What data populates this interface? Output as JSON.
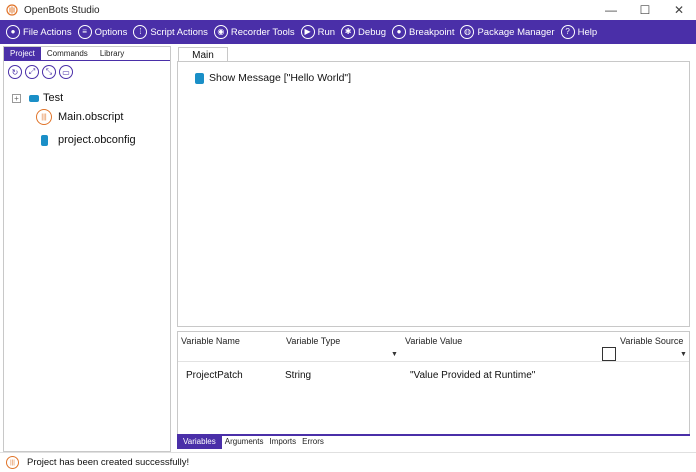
{
  "window": {
    "title": "OpenBots Studio",
    "controls": [
      "—",
      "☐",
      "✕"
    ]
  },
  "menubar": {
    "items": [
      {
        "label": "File Actions",
        "icon": "menu-circle-icon"
      },
      {
        "label": "Options",
        "icon": "options-icon"
      },
      {
        "label": "Script Actions",
        "icon": "script-icon"
      },
      {
        "label": "Recorder Tools",
        "icon": "camera-icon"
      },
      {
        "label": "Run",
        "icon": "play-icon"
      },
      {
        "label": "Debug",
        "icon": "bug-icon"
      },
      {
        "label": "Breakpoint",
        "icon": "breakpoint-icon"
      },
      {
        "label": "Package Manager",
        "icon": "package-icon"
      },
      {
        "label": "Help",
        "icon": "help-icon"
      }
    ]
  },
  "left_tabs": [
    "Project",
    "Commands",
    "Library"
  ],
  "project_tree": {
    "root": "Test",
    "expander": "+",
    "files": [
      "Main.obscript",
      "project.obconfig"
    ]
  },
  "editor": {
    "tab": "Main",
    "command": "Show Message [\"Hello World\"]"
  },
  "variables": {
    "headers": [
      "Variable Name",
      "Variable Type",
      "Variable Value",
      "Variable Source"
    ],
    "rows": [
      {
        "name": "ProjectPatch",
        "type": "String",
        "value": "\"Value Provided at Runtime\""
      }
    ]
  },
  "bottom_tabs": [
    "Variables",
    "Arguments",
    "Imports",
    "Errors"
  ],
  "status": {
    "message": "Project has been created successfully!"
  },
  "colors": {
    "accent": "#4a2fa8",
    "file_icon": "#1a8fc7",
    "script_icon": "#e0742a"
  }
}
